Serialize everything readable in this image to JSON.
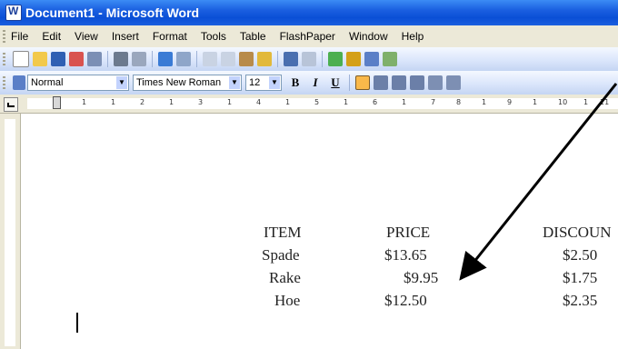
{
  "window": {
    "title": "Document1 - Microsoft Word"
  },
  "menubar": {
    "items": [
      "File",
      "Edit",
      "View",
      "Insert",
      "Format",
      "Tools",
      "Table",
      "FlashPaper",
      "Window",
      "Help"
    ]
  },
  "formatting": {
    "style": "Normal",
    "font": "Times New Roman",
    "size": "12",
    "bold": "B",
    "italic": "I",
    "underline": "U"
  },
  "ruler": {
    "marks": [
      "1",
      "1",
      "2",
      "1",
      "3",
      "1",
      "4",
      "1",
      "5",
      "1",
      "6",
      "1",
      "7",
      "8",
      "1",
      "9",
      "1",
      "10",
      "1",
      "11"
    ]
  },
  "document": {
    "table": {
      "headers": [
        "ITEM",
        "PRICE",
        "DISCOUN"
      ],
      "rows": [
        [
          "Spade",
          "$13.65",
          "$2.50"
        ],
        [
          "Rake",
          "$9.95",
          "$1.75"
        ],
        [
          "Hoe",
          "$12.50",
          "$2.35"
        ]
      ]
    }
  },
  "colors": {
    "titlebar": "#0a4fd6",
    "menubar": "#ece9d8",
    "toolbar": "#dbe6fb",
    "highlight": "#f9b84a"
  }
}
